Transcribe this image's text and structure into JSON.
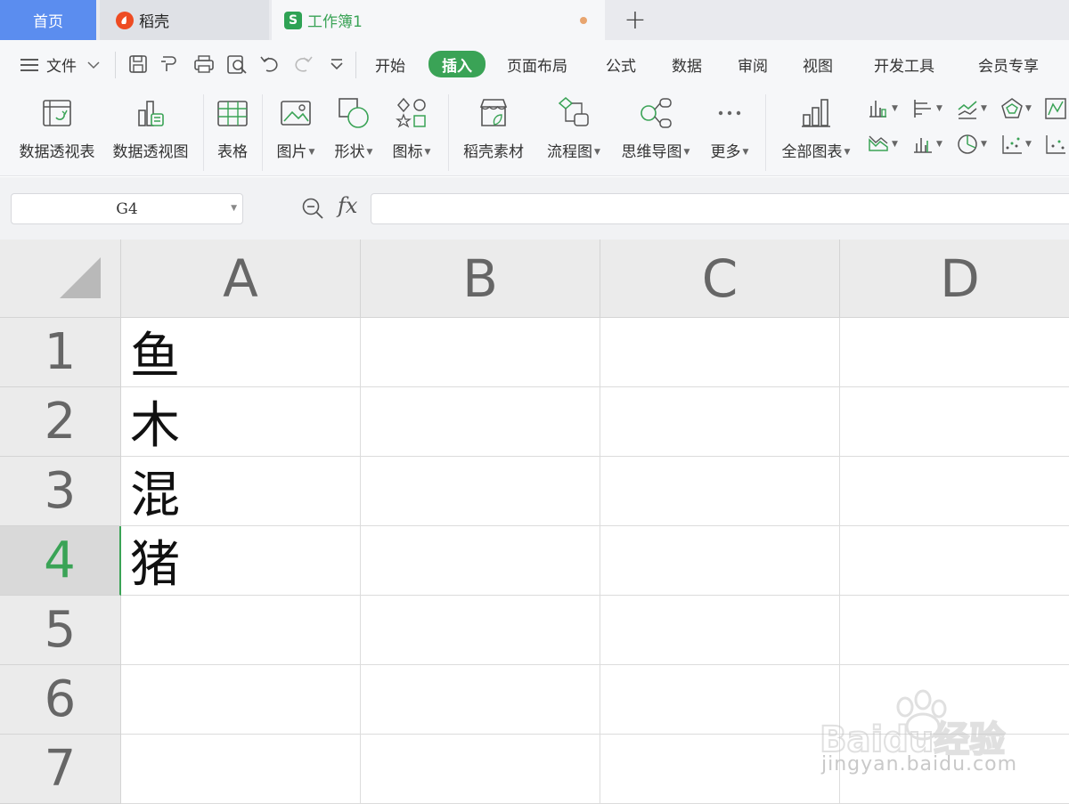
{
  "tabs": [
    {
      "label": "首页",
      "active": false
    },
    {
      "label": "稻壳",
      "active": false
    },
    {
      "label": "工作簿1",
      "active": true
    }
  ],
  "menu": {
    "file_label": "文件",
    "items": [
      "开始",
      "插入",
      "页面布局",
      "公式",
      "数据",
      "审阅",
      "视图",
      "开发工具",
      "会员专享"
    ],
    "active_item": "插入"
  },
  "ribbon": {
    "buttons": [
      {
        "label": "数据透视表",
        "dropdown": false
      },
      {
        "label": "数据透视图",
        "dropdown": false
      },
      {
        "label": "表格",
        "dropdown": false
      },
      {
        "label": "图片",
        "dropdown": true
      },
      {
        "label": "形状",
        "dropdown": true
      },
      {
        "label": "图标",
        "dropdown": true
      },
      {
        "label": "稻壳素材",
        "dropdown": false
      },
      {
        "label": "流程图",
        "dropdown": true
      },
      {
        "label": "思维导图",
        "dropdown": true
      },
      {
        "label": "更多",
        "dropdown": true
      },
      {
        "label": "全部图表",
        "dropdown": true
      }
    ]
  },
  "formula_bar": {
    "name_box": "G4",
    "fx_label": "fx",
    "formula": ""
  },
  "sheet": {
    "columns": [
      "A",
      "B",
      "C",
      "D"
    ],
    "rows": [
      "1",
      "2",
      "3",
      "4",
      "5",
      "6",
      "7"
    ],
    "active_row": "4",
    "cells": [
      [
        "鱼",
        "",
        "",
        ""
      ],
      [
        "木",
        "",
        "",
        ""
      ],
      [
        "混",
        "",
        "",
        ""
      ],
      [
        "猪",
        "",
        "",
        ""
      ],
      [
        "",
        "",
        "",
        ""
      ],
      [
        "",
        "",
        "",
        ""
      ],
      [
        "",
        "",
        "",
        ""
      ]
    ]
  },
  "watermark": {
    "brand": "Baidu经验",
    "url": "jingyan.baidu.com"
  },
  "colors": {
    "accent": "#3aa356",
    "home_tab": "#5b8def",
    "modified_dot": "#e8a56f"
  }
}
